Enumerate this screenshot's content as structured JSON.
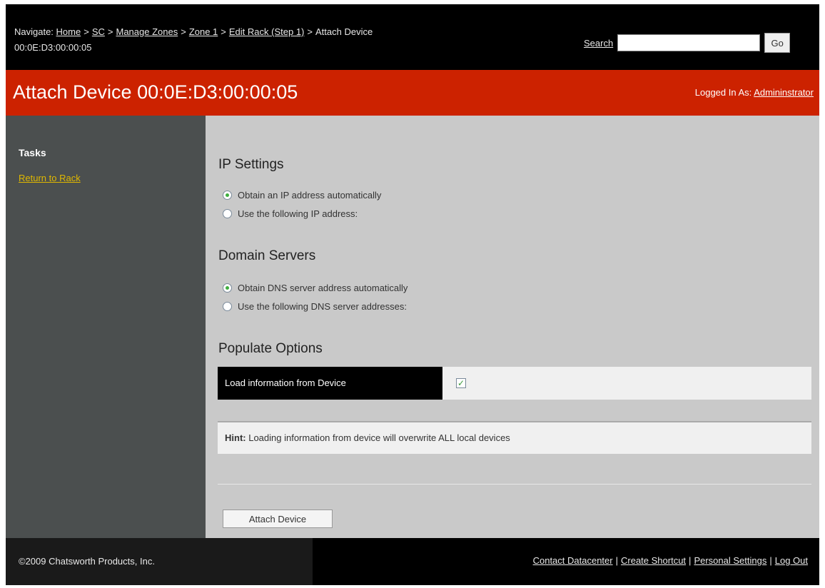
{
  "nav": {
    "prefix": "Navigate:",
    "crumbs": [
      "Home",
      "SC",
      "Manage Zones",
      "Zone 1",
      "Edit Rack (Step 1)"
    ],
    "current": "Attach Device",
    "current_line2": "00:0E:D3:00:00:05",
    "separator": ">"
  },
  "search": {
    "label": "Search",
    "value": "",
    "go_label": "Go"
  },
  "header": {
    "title": "Attach Device 00:0E:D3:00:00:05",
    "logged_in_prefix": "Logged In As:",
    "user": "Admininstrator"
  },
  "sidebar": {
    "tasks_title": "Tasks",
    "return_link": "Return to Rack"
  },
  "ip_settings": {
    "title": "IP Settings",
    "options": [
      "Obtain an IP address automatically",
      "Use the following IP address:"
    ],
    "selected": 0
  },
  "domain_servers": {
    "title": "Domain Servers",
    "options": [
      "Obtain DNS server address automatically",
      "Use the following DNS server addresses:"
    ],
    "selected": 0
  },
  "populate": {
    "title": "Populate Options",
    "load_label": "Load information from Device",
    "load_checked": true,
    "hint_bold": "Hint:",
    "hint_text": " Loading information from device will overwrite ALL local devices"
  },
  "attach_button": "Attach Device",
  "footer": {
    "copyright": "©2009 Chatsworth Products, Inc.",
    "links": [
      "Contact Datacenter",
      "Create Shortcut",
      "Personal Settings",
      "Log Out"
    ],
    "separator": "|"
  },
  "colors": {
    "red": "#cc2200",
    "sidebar": "#4b4f4f",
    "main_bg": "#c9c9c9",
    "link_yellow": "#e0b800"
  }
}
